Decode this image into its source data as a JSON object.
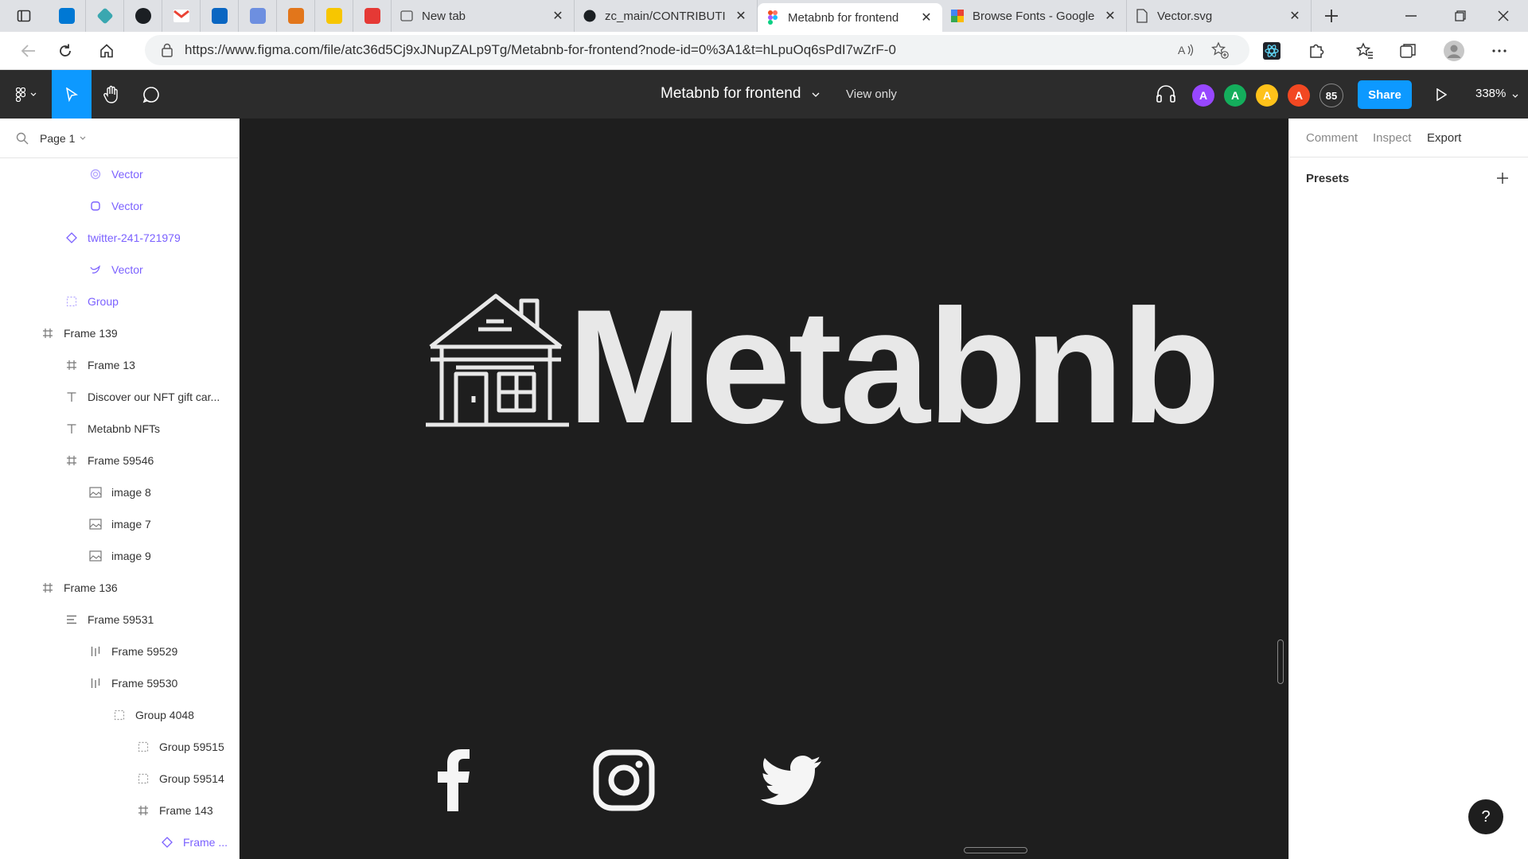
{
  "browser": {
    "tabs": [
      {
        "title": "New tab"
      },
      {
        "title": "zc_main/CONTRIBUTIN"
      },
      {
        "title": "Metabnb for frontend"
      },
      {
        "title": "Browse Fonts - Google"
      },
      {
        "title": "Vector.svg"
      }
    ],
    "url": "https://www.figma.com/file/atc36d5Cj9xJNupZALp9Tg/Metabnb-for-frontend?node-id=0%3A1&t=hLpuOq6sPdI7wZrF-0"
  },
  "figma": {
    "doc_title": "Metabnb for frontend",
    "view_only": "View only",
    "avatars": [
      {
        "initial": "A",
        "color": "#9747ff"
      },
      {
        "initial": "A",
        "color": "#14ae5c"
      },
      {
        "initial": "A",
        "color": "#ffc21a"
      },
      {
        "initial": "A",
        "color": "#f24822"
      }
    ],
    "viewer_count": "85",
    "share_label": "Share",
    "zoom": "338%"
  },
  "layers_panel": {
    "page": "Page 1",
    "layers": [
      {
        "name": "Vector",
        "icon": "vector-icon"
      },
      {
        "name": "Vector",
        "icon": "vector-icon"
      },
      {
        "name": "twitter-241-721979",
        "icon": "component-icon"
      },
      {
        "name": "Vector",
        "icon": "vector-icon"
      },
      {
        "name": "Group",
        "icon": "group-icon"
      },
      {
        "name": "Frame 139",
        "icon": "frame-icon"
      },
      {
        "name": "Frame 13",
        "icon": "frame-icon"
      },
      {
        "name": "Discover our NFT gift car...",
        "icon": "text-icon"
      },
      {
        "name": "Metabnb NFTs",
        "icon": "text-icon"
      },
      {
        "name": "Frame 59546",
        "icon": "frame-icon"
      },
      {
        "name": "image 8",
        "icon": "image-icon"
      },
      {
        "name": "image 7",
        "icon": "image-icon"
      },
      {
        "name": "image 9",
        "icon": "image-icon"
      },
      {
        "name": "Frame 136",
        "icon": "frame-icon"
      },
      {
        "name": "Frame 59531",
        "icon": "autolayout-vertical-icon"
      },
      {
        "name": "Frame 59529",
        "icon": "autolayout-horizontal-icon"
      },
      {
        "name": "Frame 59530",
        "icon": "autolayout-horizontal-icon"
      },
      {
        "name": "Group 4048",
        "icon": "group-icon"
      },
      {
        "name": "Group 59515",
        "icon": "group-icon"
      },
      {
        "name": "Group 59514",
        "icon": "group-icon"
      },
      {
        "name": "Frame 143",
        "icon": "frame-icon"
      },
      {
        "name": "Frame ...",
        "icon": "component-icon"
      }
    ]
  },
  "canvas": {
    "logo_text": "Metabnb",
    "social_icons": [
      "facebook-icon",
      "instagram-icon",
      "twitter-icon"
    ]
  },
  "right_panel": {
    "tabs": [
      "Comment",
      "Inspect",
      "Export"
    ],
    "active_tab": "Export",
    "presets_label": "Presets"
  },
  "help_label": "?"
}
